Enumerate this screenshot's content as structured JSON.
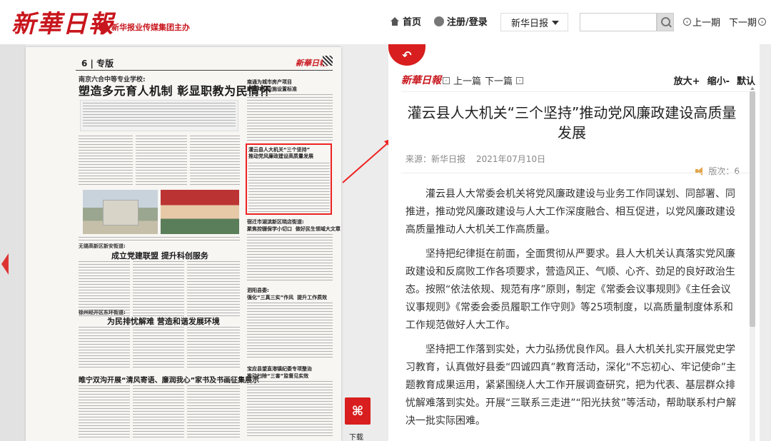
{
  "header": {
    "logo": "新華日報",
    "sublogo": "新华报业传媒集团主办",
    "nav": {
      "home": "首页",
      "login": "注册/登录"
    },
    "edition_select": "新华日报",
    "search_placeholder": "",
    "prev_issue": "上一期",
    "next_issue": "下一期"
  },
  "paper": {
    "page_num": "6",
    "page_label": "专版",
    "paper_logo": "新華日報",
    "school_head": "南京六合中等专业学校:",
    "big_head": "塑造多元育人机制  彰显职教为民情怀",
    "sec1_small": "无锡高新区新安街道:",
    "sec1_head": "成立党建联盟  提升科创服务",
    "sec2_small": "徐州经开区东环街道:",
    "sec2_head": "为民排忧解难  营造和谐发展环境",
    "sec3_head": "睢宁双沟开展“清风寄语、廉润我心”家书及书画征集展示",
    "right1": "南通为城市房产项目\n配建并卫设施设置标准",
    "right_highlight": "灌云县人大机关“三个坚持”\n推动党风廉政建设高质量发展",
    "right2": "宿迁市湖滨新区晓店街道:\n聚焦控辍保学小切口  做好民生领域大文章",
    "right3": "泗阳县委:\n强化“三真三实”作风  提升工作质效",
    "right4": "宝应县望直港镇纪委专项整治\n推动扫除“三害”监督见实效",
    "download_label": "下载"
  },
  "article": {
    "logo": "新華日報",
    "prev": "上一篇",
    "next": "下一篇",
    "zoom_in": "放大+",
    "zoom_out": "缩小-",
    "default": "默认",
    "title": "灌云县人大机关“三个坚持”推动党风廉政建设高质量发展",
    "source": "来源：新华日报",
    "date": "2021年07月10日",
    "edition": "版次：6",
    "paragraphs": [
      "灌云县人大常委会机关将党风廉政建设与业务工作同谋划、同部署、同推进，推动党风廉政建设与人大工作深度融合、相互促进，以党风廉政建设高质量推动人大机关工作高质量。",
      "坚持把纪律挺在前面，全面贯彻从严要求。县人大机关认真落实党风廉政建设和反腐败工作各项要求，营造风正、气顺、心齐、劲足的良好政治生态。按照“依法依规、规范有序”原则，制定《常委会议事规则》《主任会议议事规则》《常委会委员履职工作守则》等25项制度，以高质量制度体系和工作规范做好人大工作。",
      "坚持把工作落到实处，大力弘扬优良作风。县人大机关扎实开展党史学习教育，认真做好县委“四诚四真”教育活动，深化“不忘初心、牢记使命”主题教育成果运用，紧紧围绕人大工作开展调查研究，把为代表、基层群众排忧解难落到实处。开展“三联系三走进”“阳光扶贫”等活动，帮助联系村户解决一批实际困难。"
    ]
  }
}
